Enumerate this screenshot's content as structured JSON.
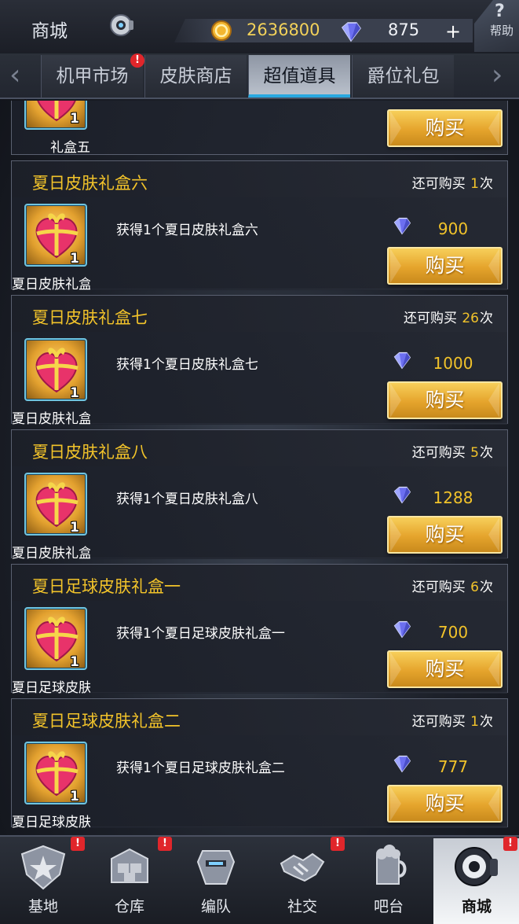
{
  "header": {
    "title": "商城",
    "gold": "2636800",
    "gems": "875",
    "plus": "+",
    "help_label": "帮助",
    "help_mark": "?"
  },
  "tabs": [
    {
      "label": "机甲市场",
      "badge": "!"
    },
    {
      "label": "皮肤商店"
    },
    {
      "label": "超值道具",
      "active": true
    },
    {
      "label": "爵位礼包"
    }
  ],
  "partial_item": {
    "short_name": "礼盒五",
    "short_name_full": "夏日皮肤礼盒五",
    "qty": "1",
    "buy_label": "购买"
  },
  "items": [
    {
      "name": "夏日皮肤礼盒六",
      "remain_prefix": "还可购买",
      "remain_count": "1",
      "remain_suffix": "次",
      "desc": "获得1个夏日皮肤礼盒六",
      "price": "900",
      "qty": "1",
      "short_name": "夏日皮肤礼盒六",
      "buy_label": "购买"
    },
    {
      "name": "夏日皮肤礼盒七",
      "remain_prefix": "还可购买",
      "remain_count": "26",
      "remain_suffix": "次",
      "desc": "获得1个夏日皮肤礼盒七",
      "price": "1000",
      "qty": "1",
      "short_name": "夏日皮肤礼盒七",
      "buy_label": "购买"
    },
    {
      "name": "夏日皮肤礼盒八",
      "remain_prefix": "还可购买",
      "remain_count": "5",
      "remain_suffix": "次",
      "desc": "获得1个夏日皮肤礼盒八",
      "price": "1288",
      "qty": "1",
      "short_name": "夏日皮肤礼盒八",
      "buy_label": "购买"
    },
    {
      "name": "夏日足球皮肤礼盒一",
      "remain_prefix": "还可购买",
      "remain_count": "6",
      "remain_suffix": "次",
      "desc": "获得1个夏日足球皮肤礼盒一",
      "price": "700",
      "qty": "1",
      "short_name": "夏日足球皮肤礼盒一",
      "buy_label": "购买"
    },
    {
      "name": "夏日足球皮肤礼盒二",
      "remain_prefix": "还可购买",
      "remain_count": "1",
      "remain_suffix": "次",
      "desc": "获得1个夏日足球皮肤礼盒二",
      "price": "777",
      "qty": "1",
      "short_name": "夏日足球皮肤礼盒二",
      "buy_label": "购买"
    }
  ],
  "nav": [
    {
      "label": "基地",
      "icon": "base-icon",
      "badge": "!"
    },
    {
      "label": "仓库",
      "icon": "warehouse-icon",
      "badge": "!"
    },
    {
      "label": "编队",
      "icon": "formation-icon"
    },
    {
      "label": "社交",
      "icon": "social-icon",
      "badge": "!"
    },
    {
      "label": "吧台",
      "icon": "bar-icon"
    },
    {
      "label": "商城",
      "icon": "shop-icon",
      "badge": "!",
      "active": true
    }
  ],
  "colors": {
    "accent_gold": "#f2c32a",
    "button_gold": "#e5a42c",
    "badge_red": "#e0262b",
    "tab_active_underline": "#2aa8e0"
  }
}
